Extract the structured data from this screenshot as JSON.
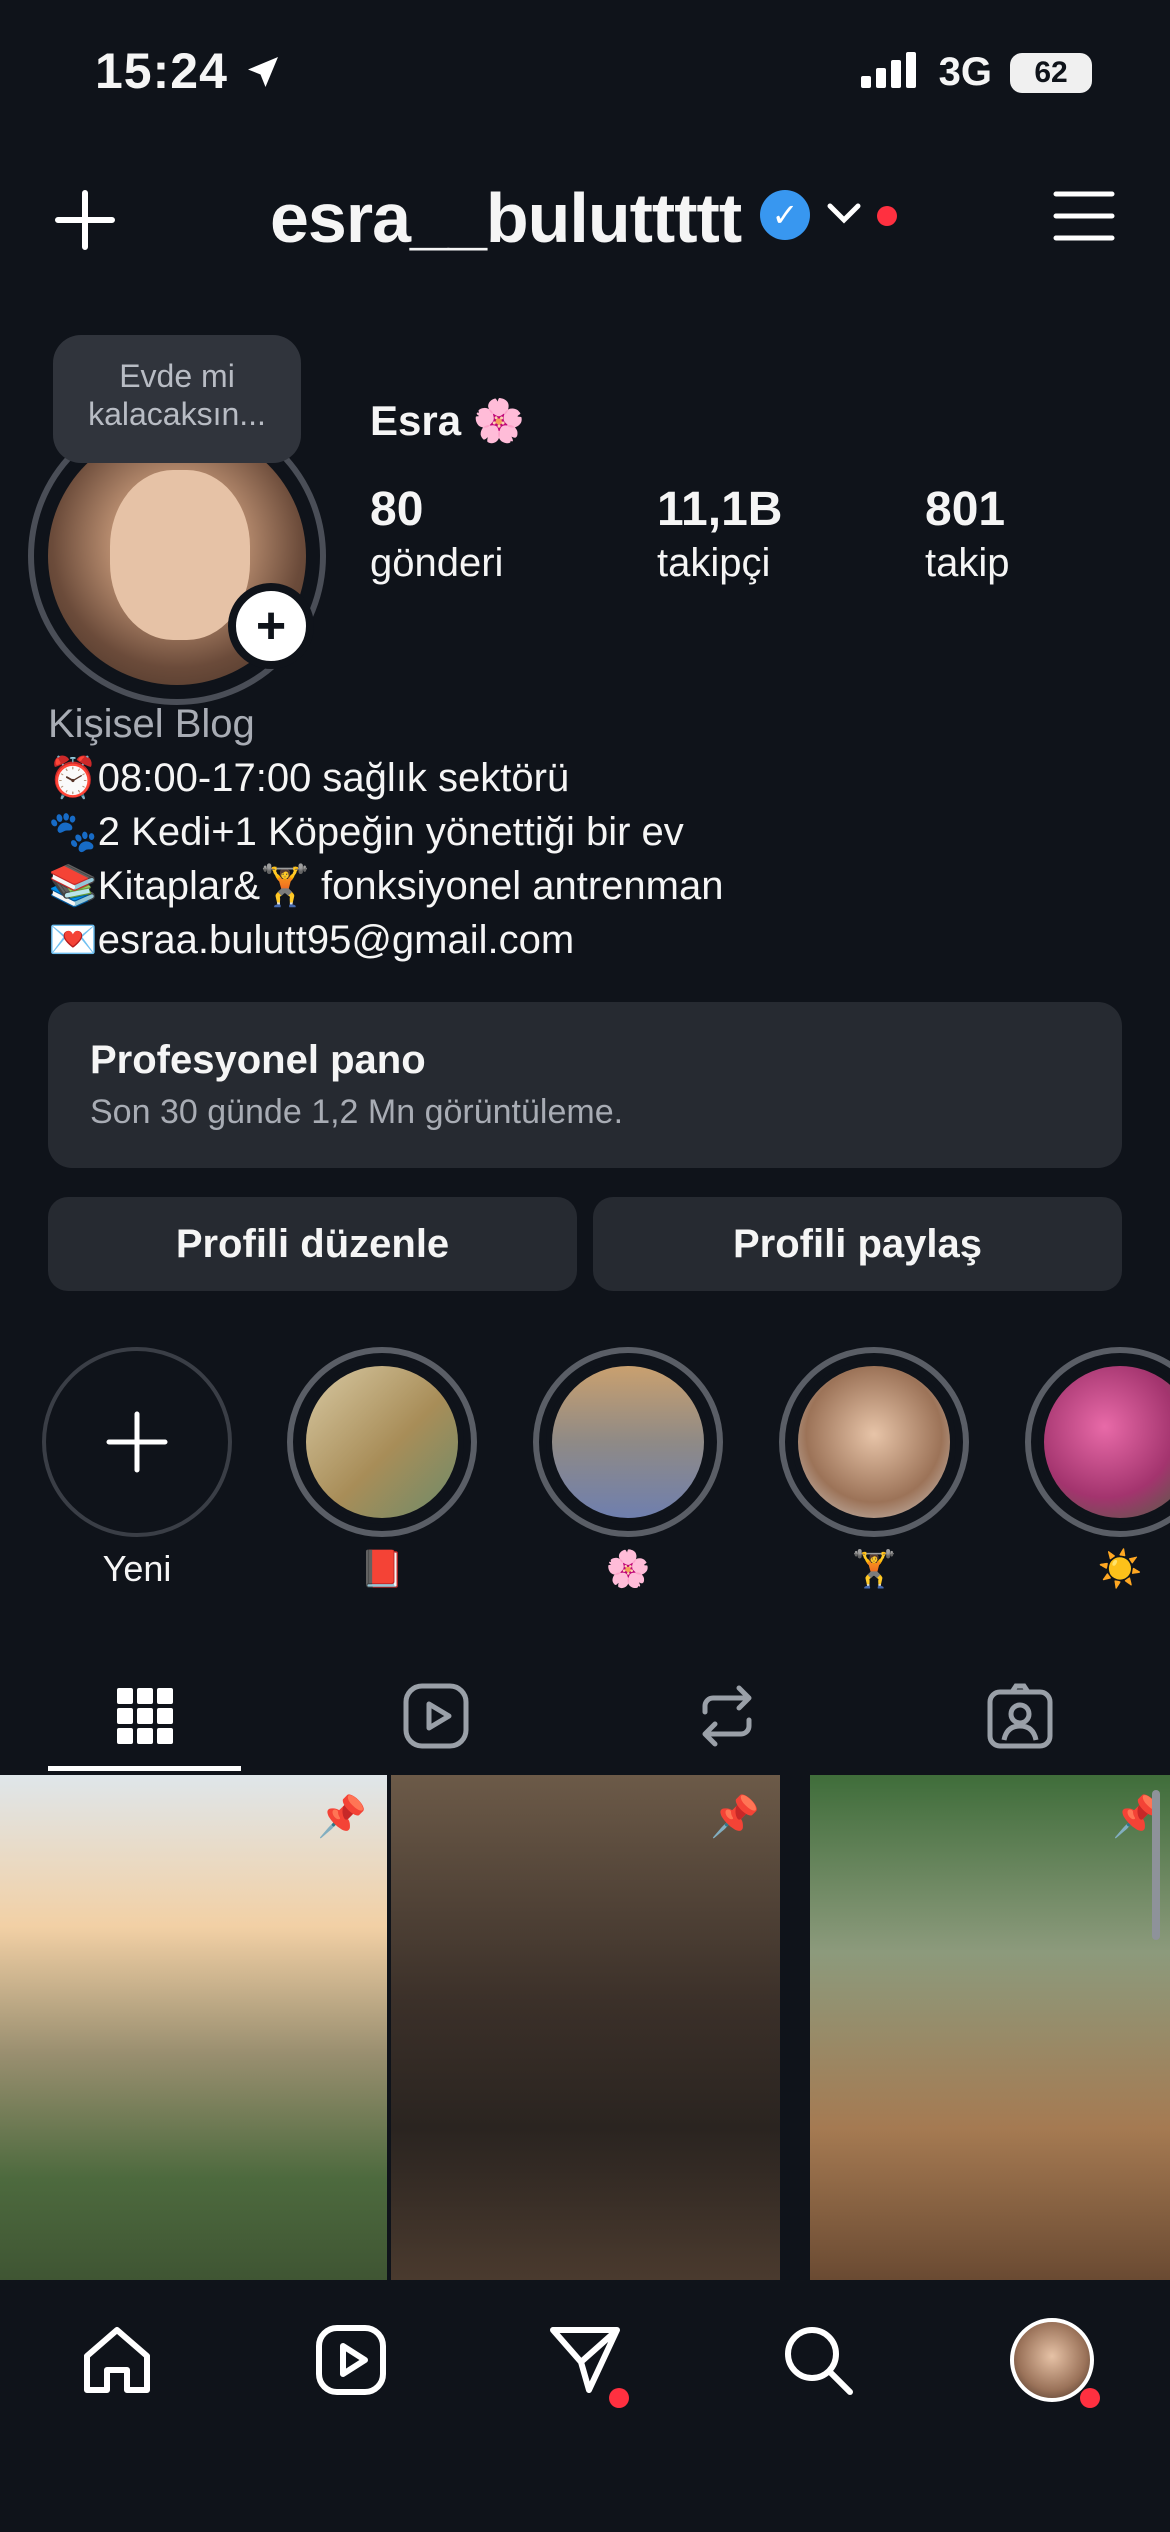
{
  "status_bar": {
    "time": "15:24",
    "network": "3G",
    "battery": "62"
  },
  "header": {
    "username": "esra__buluttttt"
  },
  "profile": {
    "note_bubble": "Evde mi kalacaksın...",
    "display_name": "Esra 🌸",
    "stats": [
      {
        "value": "80",
        "label": "gönderi"
      },
      {
        "value": "11,1B",
        "label": "takipçi"
      },
      {
        "value": "801",
        "label": "takip"
      }
    ],
    "bio_category": "Kişisel Blog",
    "bio_lines": [
      "⏰08:00-17:00 sağlık sektörü",
      "🐾2 Kedi+1 Köpeğin yönettiği bir ev",
      "📚Kitaplar&🏋️ fonksiyonel antrenman",
      "💌esraa.bulutt95@gmail.com"
    ]
  },
  "dashboard": {
    "title": "Profesyonel pano",
    "subtitle": "Son 30 günde 1,2 Mn görüntüleme."
  },
  "actions": {
    "edit": "Profili düzenle",
    "share": "Profili paylaş"
  },
  "highlights": [
    {
      "label": "Yeni"
    },
    {
      "label": "📕"
    },
    {
      "label": "🌸"
    },
    {
      "label": "🏋️"
    },
    {
      "label": "☀️"
    }
  ],
  "colors": {
    "background": "#0f131a",
    "surface": "#262a31",
    "verified": "#3897f0",
    "notification": "#ff3040"
  }
}
